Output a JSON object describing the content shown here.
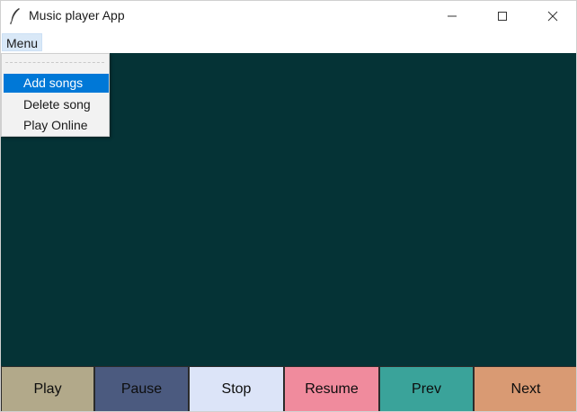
{
  "window": {
    "title": "Music player App",
    "icon": "feather-icon"
  },
  "menubar": {
    "menu_label": "Menu"
  },
  "dropdown": {
    "items": [
      {
        "label": "Add songs",
        "highlighted": true
      },
      {
        "label": "Delete song",
        "highlighted": false
      },
      {
        "label": "Play Online",
        "highlighted": false
      }
    ]
  },
  "canvas": {
    "background": "#053336"
  },
  "controls": {
    "buttons": [
      {
        "label": "Play",
        "color": "#b2a98a"
      },
      {
        "label": "Pause",
        "color": "#4b5a7f"
      },
      {
        "label": "Stop",
        "color": "#dce4f8"
      },
      {
        "label": "Resume",
        "color": "#f08b9d"
      },
      {
        "label": "Prev",
        "color": "#3aa39a"
      },
      {
        "label": "Next",
        "color": "#d99a73"
      }
    ]
  },
  "colors": {
    "menu_highlight": "#0078d7",
    "menu_tab_bg": "#d9e8f7"
  }
}
